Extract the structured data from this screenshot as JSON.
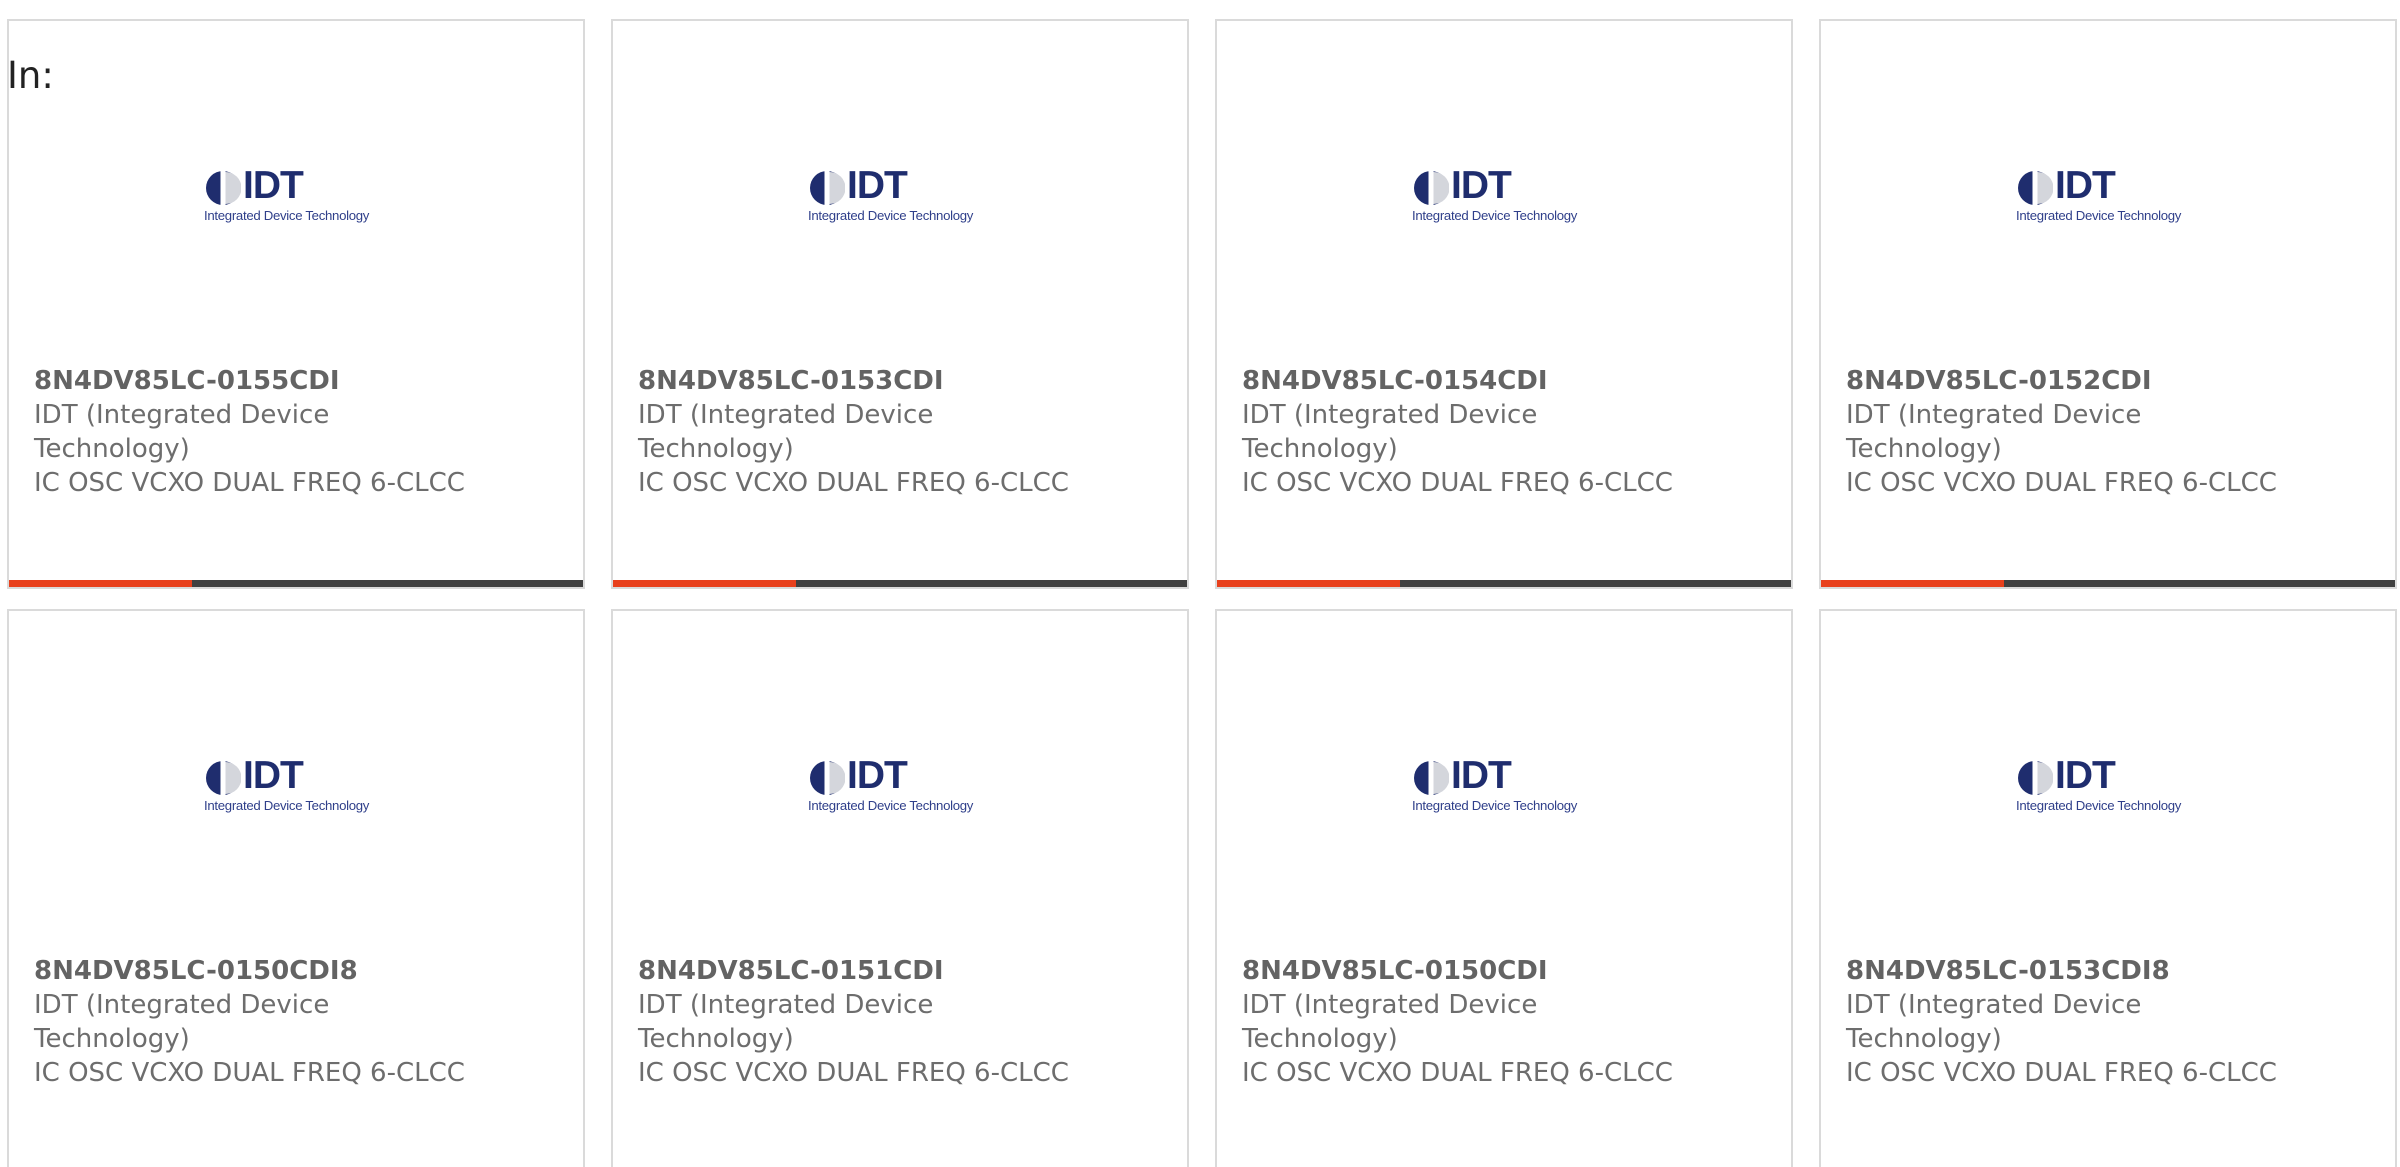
{
  "header": {
    "in_label": "In:"
  },
  "brand": {
    "logo_word": "IDT",
    "logo_tagline": "Integrated Device Technology",
    "logo_color": "#1f2d6e",
    "accent_color": "#e8401c",
    "bar_color": "#404040"
  },
  "products": [
    {
      "part": "8N4DV85LC-0155CDI",
      "manufacturer": "IDT (Integrated Device Technology)",
      "description": "IC OSC VCXO DUAL FREQ 6-CLCC"
    },
    {
      "part": "8N4DV85LC-0153CDI",
      "manufacturer": "IDT (Integrated Device Technology)",
      "description": "IC OSC VCXO DUAL FREQ 6-CLCC"
    },
    {
      "part": "8N4DV85LC-0154CDI",
      "manufacturer": "IDT (Integrated Device Technology)",
      "description": "IC OSC VCXO DUAL FREQ 6-CLCC"
    },
    {
      "part": "8N4DV85LC-0152CDI",
      "manufacturer": "IDT (Integrated Device Technology)",
      "description": "IC OSC VCXO DUAL FREQ 6-CLCC"
    },
    {
      "part": "8N4DV85LC-0150CDI8",
      "manufacturer": "IDT (Integrated Device Technology)",
      "description": "IC OSC VCXO DUAL FREQ 6-CLCC"
    },
    {
      "part": "8N4DV85LC-0151CDI",
      "manufacturer": "IDT (Integrated Device Technology)",
      "description": "IC OSC VCXO DUAL FREQ 6-CLCC"
    },
    {
      "part": "8N4DV85LC-0150CDI",
      "manufacturer": "IDT (Integrated Device Technology)",
      "description": "IC OSC VCXO DUAL FREQ 6-CLCC"
    },
    {
      "part": "8N4DV85LC-0153CDI8",
      "manufacturer": "IDT (Integrated Device Technology)",
      "description": "IC OSC VCXO DUAL FREQ 6-CLCC"
    }
  ]
}
